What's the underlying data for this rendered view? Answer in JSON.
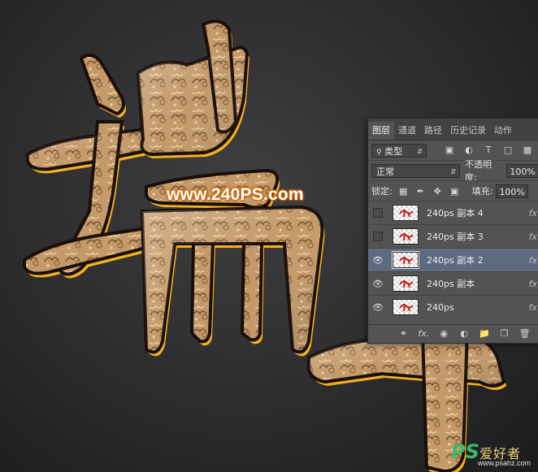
{
  "watermark": "www.240PS.com",
  "panel": {
    "tabs": [
      "图层",
      "通道",
      "路径",
      "历史记录",
      "动作"
    ],
    "active_tab": 0,
    "filter": {
      "kind_label": "类型"
    },
    "blend": {
      "mode": "正常",
      "opacity_label": "不透明度:",
      "opacity_value": "100%"
    },
    "lock": {
      "label": "锁定:",
      "fill_label": "填充:",
      "fill_value": "100%"
    },
    "layers": [
      {
        "name": "240ps 副本 4",
        "visible": false,
        "selected": false,
        "fx": "fx"
      },
      {
        "name": "240ps 副本 3",
        "visible": false,
        "selected": false,
        "fx": "fx"
      },
      {
        "name": "240ps 副本 2",
        "visible": true,
        "selected": true,
        "fx": "fx"
      },
      {
        "name": "240ps 副本",
        "visible": true,
        "selected": false,
        "fx": "fx"
      },
      {
        "name": "240ps",
        "visible": true,
        "selected": false,
        "fx": "fx"
      }
    ],
    "bottom_icons": [
      "link-icon",
      "fx-icon",
      "mask-icon",
      "adjustment-icon",
      "folder-icon",
      "new-layer-icon",
      "trash-icon"
    ],
    "bottom_fx_label": "fx."
  },
  "logo": {
    "ps": "PS",
    "cn": "爱好者",
    "url": "www.psahz.com"
  },
  "colors": {
    "gold": "#c9a06a",
    "gold_edge": "#f0b020",
    "dark_red_edge": "#5a1a0e",
    "panel_bg": "#535353",
    "selected_row": "#5d6b80"
  }
}
